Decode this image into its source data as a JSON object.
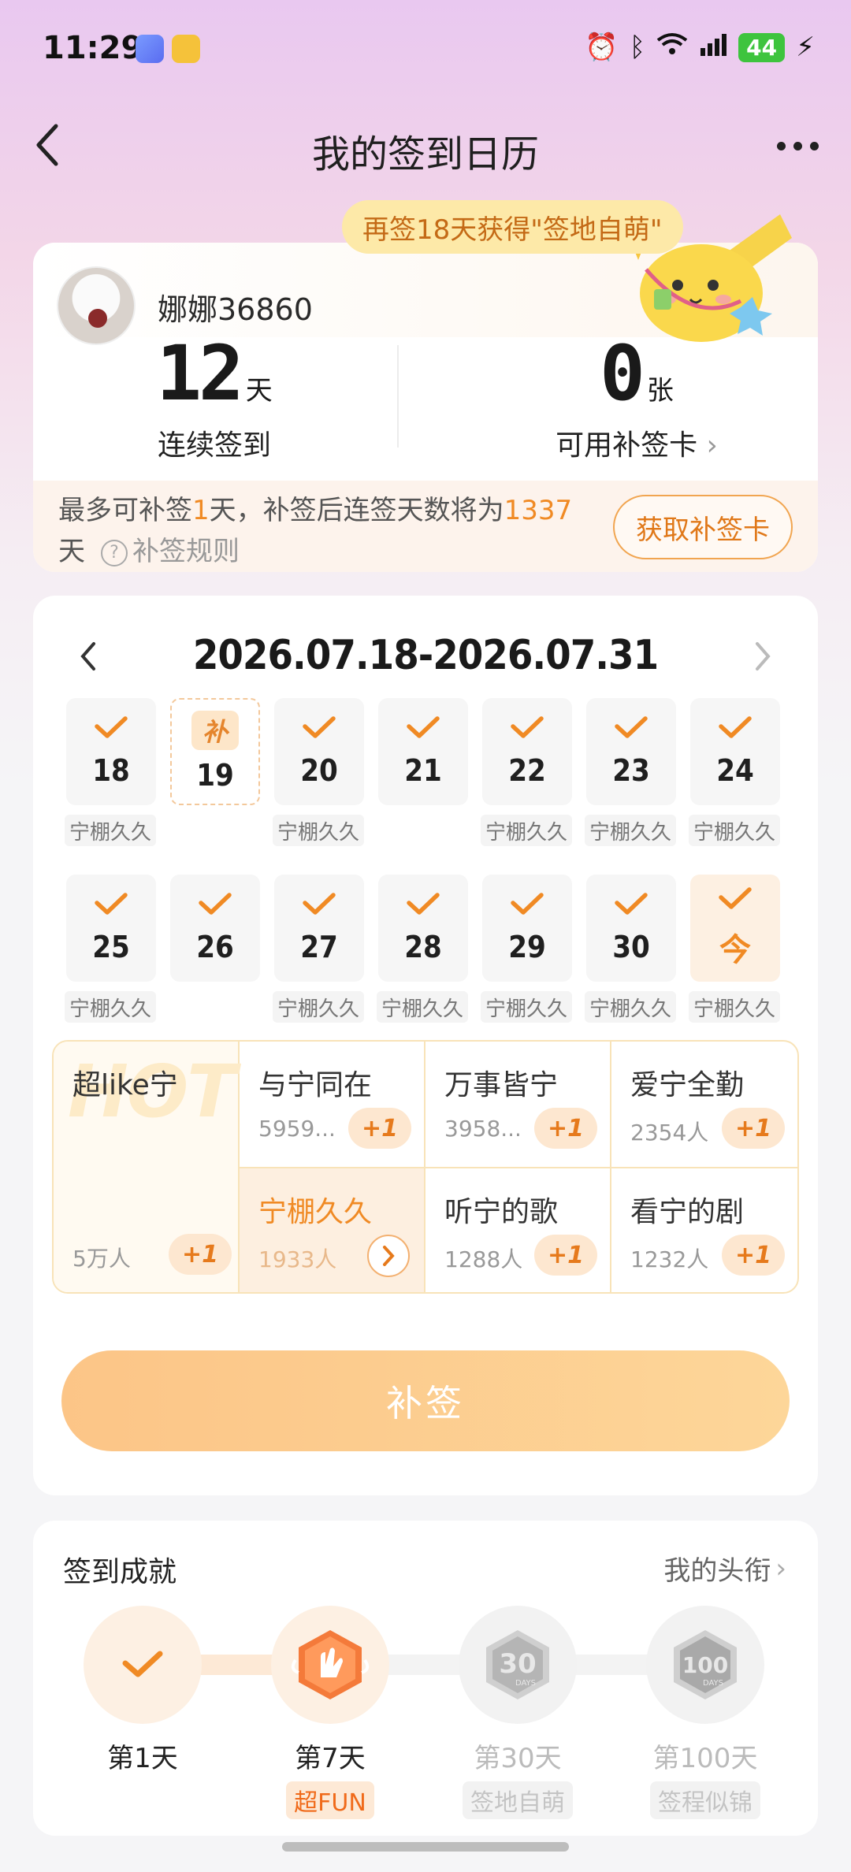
{
  "status_bar": {
    "time": "11:29",
    "battery": "44"
  },
  "nav": {
    "title": "我的签到日历"
  },
  "summary": {
    "promo": "再签18天获得\"签地自萌\"",
    "username": "娜娜36860",
    "streak_value": "12",
    "streak_unit": "天",
    "streak_label": "连续签到",
    "cards_value": "0",
    "cards_unit": "张",
    "cards_label": "可用补签卡",
    "makeup_text_1": "最多可补签",
    "makeup_days": "1",
    "makeup_text_2": "天，补签后连签天数将为",
    "makeup_total": "1337",
    "makeup_text_3": "天",
    "rules_label": "补签规则",
    "get_card_label": "获取补签卡"
  },
  "calendar": {
    "range": "2026.07.18-2026.07.31",
    "makeup_badge": "补",
    "today_label": "今",
    "days": [
      {
        "num": "18",
        "tag": "宁棚久久"
      },
      {
        "num": "19",
        "tag": ""
      },
      {
        "num": "20",
        "tag": "宁棚久久"
      },
      {
        "num": "21",
        "tag": ""
      },
      {
        "num": "22",
        "tag": "宁棚久久"
      },
      {
        "num": "23",
        "tag": "宁棚久久"
      },
      {
        "num": "24",
        "tag": "宁棚久久"
      },
      {
        "num": "25",
        "tag": "宁棚久久"
      },
      {
        "num": "26",
        "tag": ""
      },
      {
        "num": "27",
        "tag": "宁棚久久"
      },
      {
        "num": "28",
        "tag": "宁棚久久"
      },
      {
        "num": "29",
        "tag": "宁棚久久"
      },
      {
        "num": "30",
        "tag": "宁棚久久"
      },
      {
        "num": "今",
        "tag": "宁棚久久"
      }
    ],
    "topics": {
      "hot": {
        "watermark": "HOT",
        "name": "超like宁",
        "count": "5万人",
        "plus": "+1"
      },
      "items": [
        {
          "name": "与宁同在",
          "count": "5959...",
          "plus": "+1"
        },
        {
          "name": "万事皆宁",
          "count": "3958...",
          "plus": "+1"
        },
        {
          "name": "爱宁全勤",
          "count": "2354人",
          "plus": "+1"
        },
        {
          "name": "宁棚久久",
          "count": "1933人"
        },
        {
          "name": "听宁的歌",
          "count": "1288人",
          "plus": "+1"
        },
        {
          "name": "看宁的剧",
          "count": "1232人",
          "plus": "+1"
        }
      ]
    },
    "makeup_button": "补签"
  },
  "achievements": {
    "title": "签到成就",
    "link": "我的头衔",
    "items": [
      {
        "day": "第1天",
        "name": ""
      },
      {
        "day": "第7天",
        "name": "超FUN"
      },
      {
        "day": "第30天",
        "name": "签地自萌"
      },
      {
        "day": "第100天",
        "name": "签程似锦"
      }
    ]
  },
  "colors": {
    "accent": "#f08a24",
    "button": "#fcc587",
    "badge_bg": "#fde7d0"
  }
}
